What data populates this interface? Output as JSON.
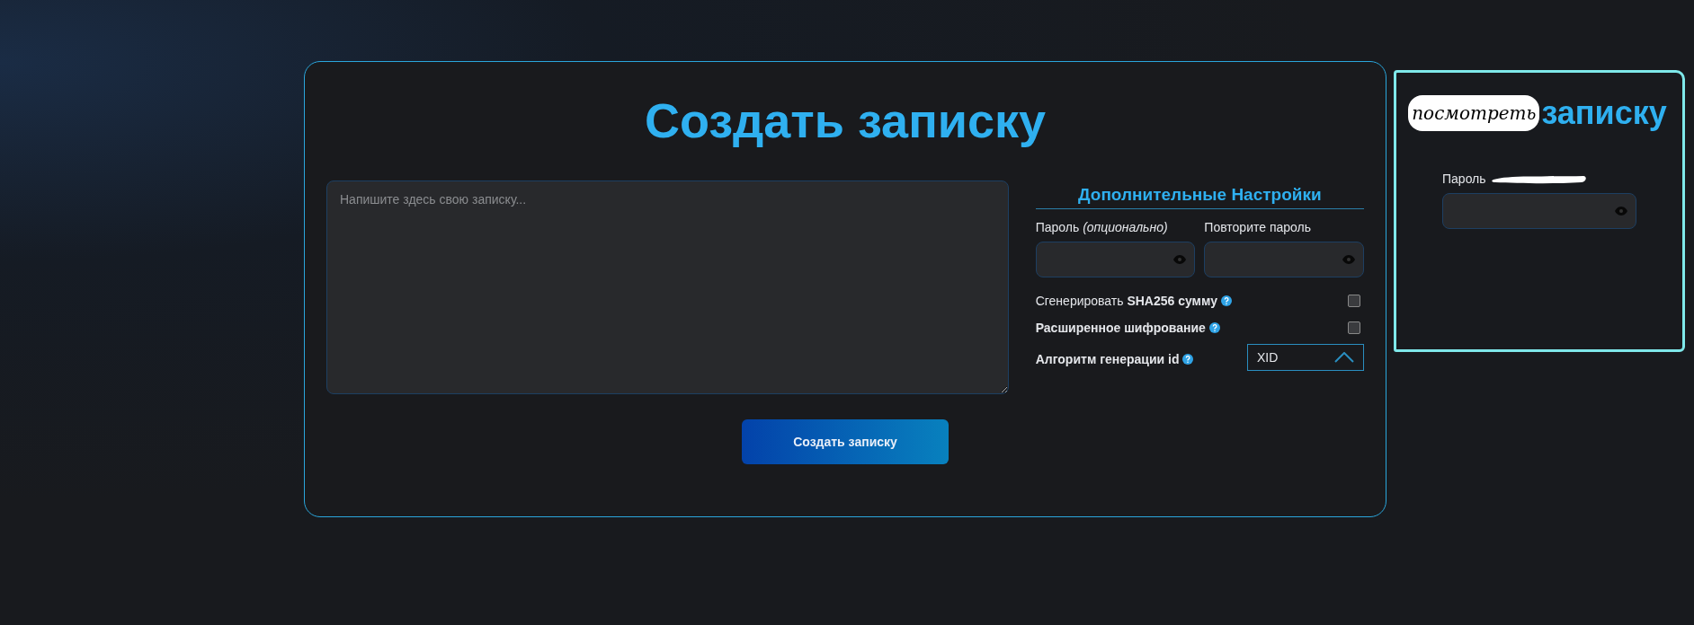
{
  "create_panel": {
    "title": "Создать записку",
    "note_field": {
      "placeholder": "Напишите здесь свою записку..."
    },
    "settings": {
      "heading": "Дополнительные Настройки",
      "password": {
        "label": "Пароль",
        "label_hint": "(опционально)"
      },
      "repeat_password": {
        "label": "Повторите пароль"
      },
      "options": [
        {
          "kind": "checkbox",
          "label": "Сгенерировать **SHA256 сумму**",
          "checked": false
        },
        {
          "kind": "checkbox",
          "label": "**Расширенное шифрование**",
          "checked": false
        },
        {
          "kind": "select",
          "label": "**Алгоритм генерации id**",
          "value": "XID",
          "expanded": true
        }
      ]
    },
    "submit_button": "Создать записку"
  },
  "view_sketch": {
    "title_handwritten": "посмотреть",
    "title": "записку",
    "password_label": "Пароль"
  }
}
